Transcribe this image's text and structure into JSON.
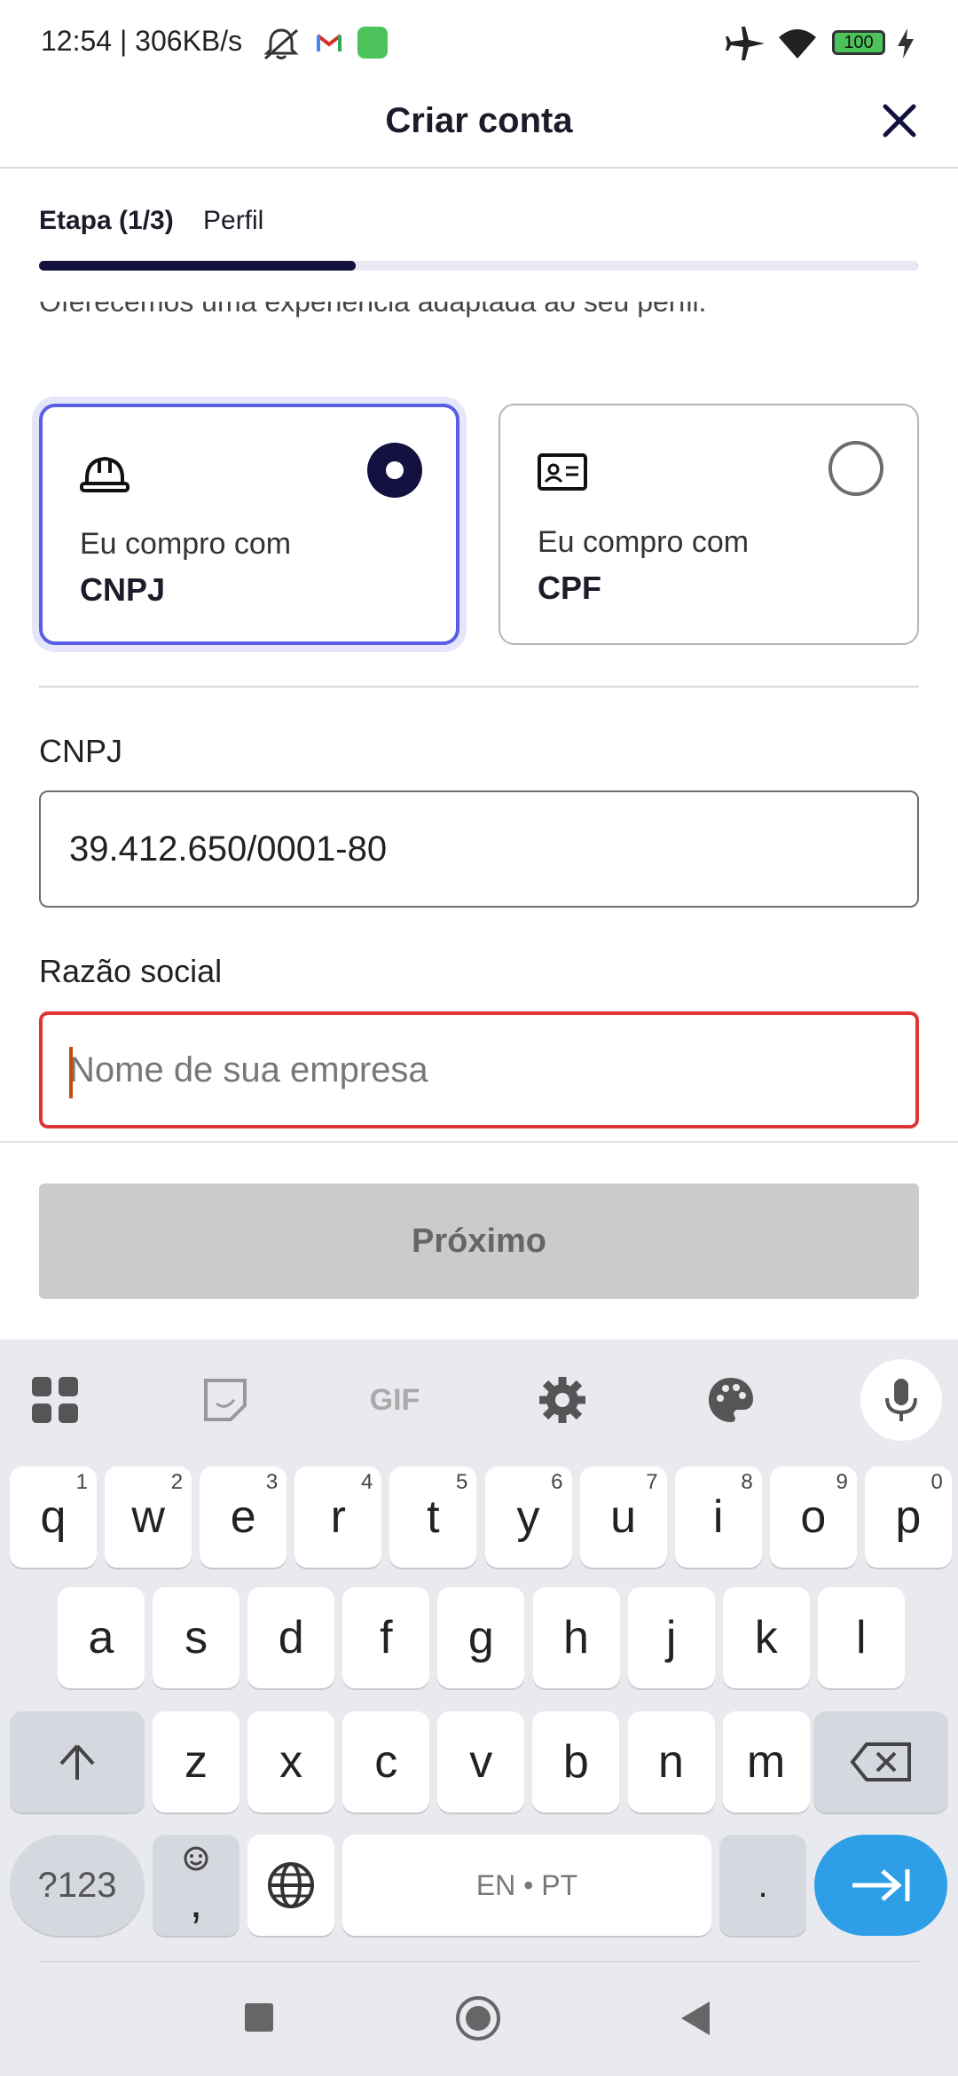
{
  "status_bar": {
    "time_speed": "12:54 | 306KB/s",
    "battery": "100"
  },
  "header": {
    "title": "Criar conta",
    "close_icon": "close-icon"
  },
  "step": {
    "label": "Etapa (1/3)",
    "name": "Perfil",
    "progress": 0.36
  },
  "intro_text": "Oferecemos uma experiência adaptada ao seu perfil.",
  "options": [
    {
      "line1": "Eu compro com",
      "line2": "CNPJ",
      "icon": "hard-hat-icon",
      "selected": true
    },
    {
      "line1": "Eu compro com",
      "line2": "CPF",
      "icon": "id-card-icon",
      "selected": false
    }
  ],
  "fields": {
    "cnpj": {
      "label": "CNPJ",
      "value": "39.412.650/0001-80"
    },
    "razao": {
      "label": "Razão social",
      "placeholder": "Nome de sua empresa",
      "value": ""
    }
  },
  "next_button": "Próximo",
  "keyboard": {
    "row1": [
      [
        "q",
        "1"
      ],
      [
        "w",
        "2"
      ],
      [
        "e",
        "3"
      ],
      [
        "r",
        "4"
      ],
      [
        "t",
        "5"
      ],
      [
        "y",
        "6"
      ],
      [
        "u",
        "7"
      ],
      [
        "i",
        "8"
      ],
      [
        "o",
        "9"
      ],
      [
        "p",
        "0"
      ]
    ],
    "row2": [
      "a",
      "s",
      "d",
      "f",
      "g",
      "h",
      "j",
      "k",
      "l"
    ],
    "row3": [
      "z",
      "x",
      "c",
      "v",
      "b",
      "n",
      "m"
    ],
    "symbols": "?123",
    "comma": ",",
    "space": "EN • PT",
    "period": ".",
    "gif": "GIF"
  },
  "colors": {
    "accent": "#12113f",
    "selected_border": "#5a5ee6",
    "error": "#e03535",
    "enter_key": "#2e9fe6"
  }
}
